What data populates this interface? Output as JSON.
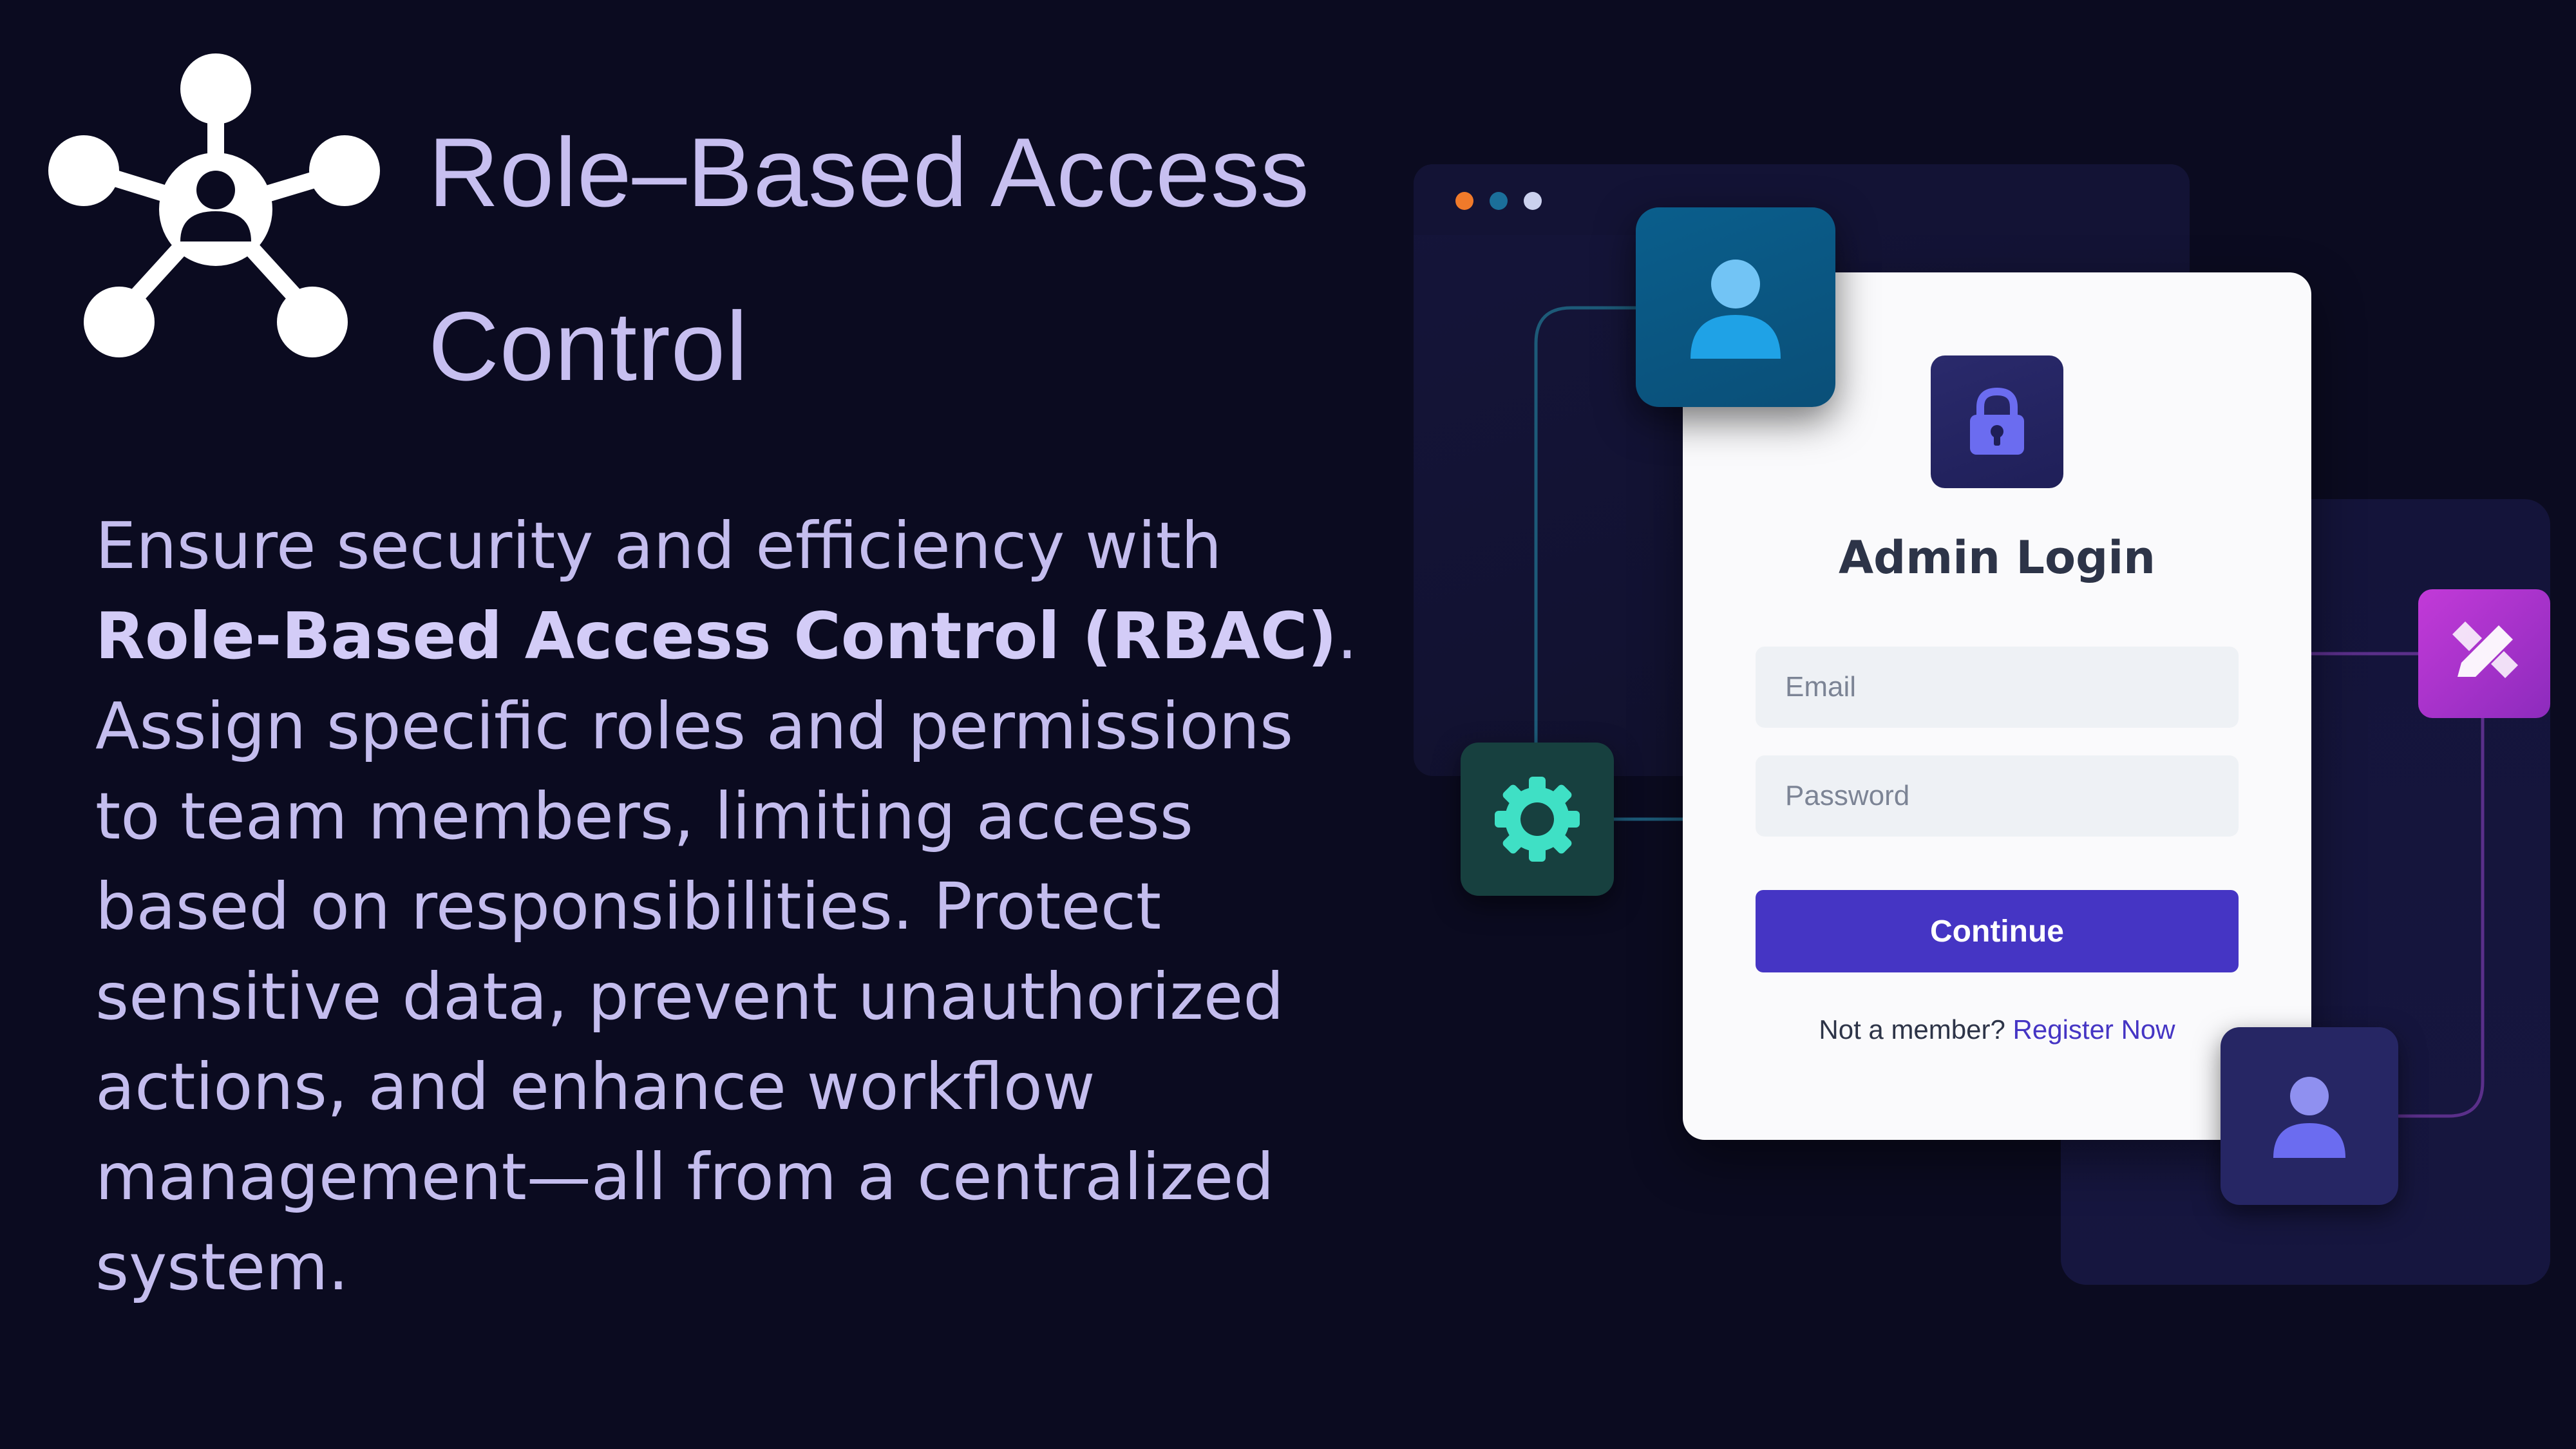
{
  "header": {
    "icon": "network-user-hub-icon",
    "title_line1": "Role–Based Access",
    "title_line2": "Control"
  },
  "description": {
    "line1": "Ensure security and efficiency with",
    "line2_bold": "Role-Based Access Control (RBAC)",
    "line2_end": ".",
    "line3": "Assign specific roles and permissions",
    "line4": "to team members, limiting access",
    "line5": "based on responsibilities. Protect",
    "line6": "sensitive data, prevent unauthorized",
    "line7": "actions, and enhance workflow",
    "line8": "management—all from a centralized",
    "line9": "system."
  },
  "illustration": {
    "window_dots": [
      "#f07a2a",
      "#1b6f9a",
      "#cbd1ee"
    ],
    "icons": [
      "user-icon",
      "gear-icon",
      "edit-icon",
      "user-icon"
    ],
    "colors": {
      "user_top_tile": "#0a5e8c",
      "gear_tile": "#17403f",
      "gear_color": "#3fe0c5",
      "edit_tile": "#c23ad8",
      "user_bottom_tile": "#262664",
      "accent": "#4535c4"
    }
  },
  "login": {
    "icon": "lock-icon",
    "title": "Admin Login",
    "email_placeholder": "Email",
    "password_placeholder": "Password",
    "continue_label": "Continue",
    "member_prompt": "Not a member?",
    "register_link": "Register Now"
  }
}
